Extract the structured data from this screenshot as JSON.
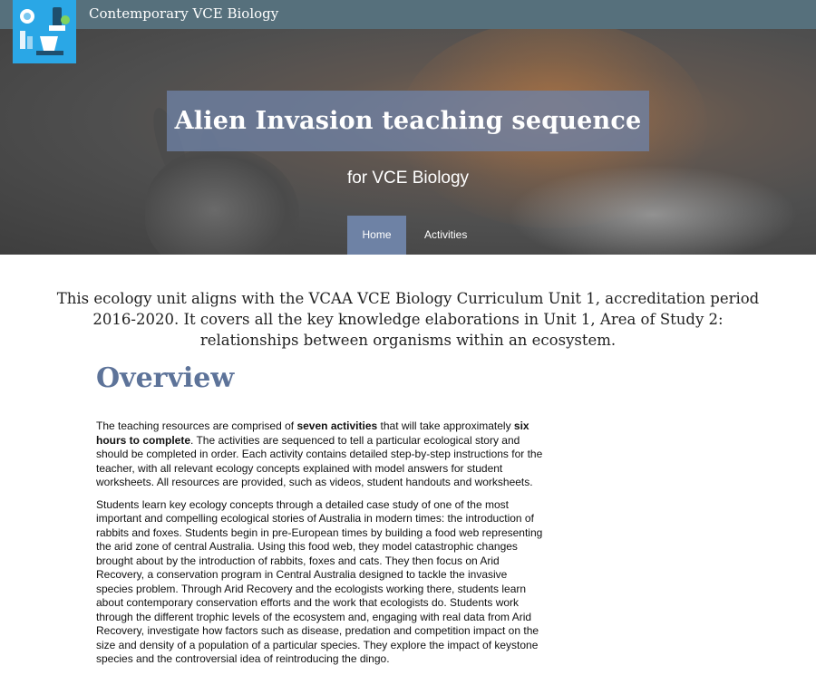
{
  "header": {
    "site_title": "Contemporary VCE Biology"
  },
  "hero": {
    "title": "Alien Invasion teaching sequence",
    "subtitle": "for VCE Biology"
  },
  "nav": {
    "items": [
      {
        "label": "Home"
      },
      {
        "label": "Activities"
      }
    ]
  },
  "intro": "This ecology unit aligns with the VCAA VCE Biology Curriculum Unit 1, accreditation period 2016-2020. It covers all the key knowledge elaborations in Unit 1, Area of Study 2: relationships between organisms within an ecosystem.",
  "overview": {
    "heading": "Overview",
    "p1_a": "The teaching resources are comprised of ",
    "p1_b": "seven activities",
    "p1_c": " that will take approximately ",
    "p1_d": "six hours to complete",
    "p1_e": ". The activities are sequenced to tell a particular ecological story and should be completed in order. Each activity contains detailed step-by-step instructions for the teacher, with all relevant ecology concepts explained with model answers for student worksheets. All resources are provided, such as videos, student handouts and worksheets.",
    "p2": "Students learn key ecology concepts through a detailed case study of one of the most important and compelling ecological stories of Australia in modern times: the introduction of rabbits and foxes. Students begin in pre-European times by building a food web representing the arid zone of central Australia. Using this food web, they model catastrophic changes brought about by the introduction of rabbits, foxes and cats. They then focus on Arid Recovery, a conservation program in Central Australia designed to tackle the invasive species problem. Through Arid Recovery and the ecologists working there, students learn about contemporary conservation efforts and the work that ecologists do. Students work through the different trophic levels of the ecosystem and, engaging with real data from Arid Recovery, investigate how factors such as disease, predation and competition impact on the size and density of a population of a particular species. They explore the impact of keystone species and the controversial idea of reintroducing the dingo."
  },
  "colors": {
    "topbar": "#56707c",
    "accent": "#6e82a5",
    "heading": "#5d7399",
    "logo_bg": "#2aa7e6"
  }
}
